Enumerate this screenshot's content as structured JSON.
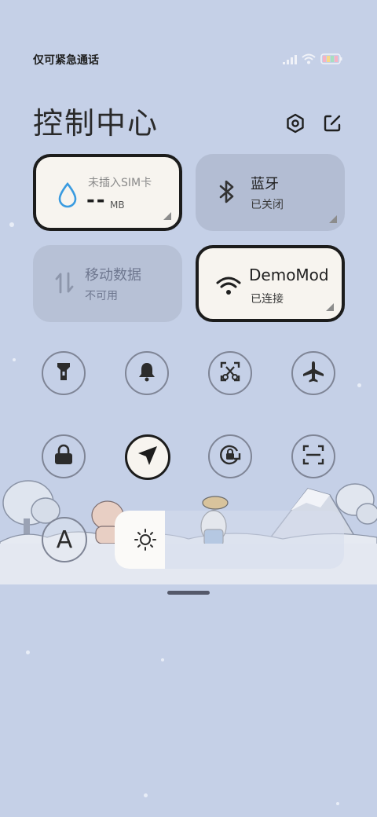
{
  "status": {
    "carrier_text": "仅可紧急通话",
    "icons": [
      "signal-icon",
      "wifi-icon",
      "battery-icon"
    ]
  },
  "header": {
    "title": "控制中心",
    "settings_icon": "gear-icon",
    "edit_icon": "edit-icon"
  },
  "tiles": {
    "data_usage": {
      "title": "未插入SIM卡",
      "value": "--",
      "unit": "MB"
    },
    "bluetooth": {
      "title": "蓝牙",
      "status": "已关闭"
    },
    "mobile_data": {
      "title": "移动数据",
      "status": "不可用"
    },
    "wifi": {
      "title": "DemoMod",
      "status": "已连接"
    }
  },
  "toggles_row1": [
    "flashlight-icon",
    "bell-icon",
    "screenshot-icon",
    "airplane-icon"
  ],
  "toggles_row2": [
    "lock-icon",
    "location-icon",
    "rotation-lock-icon",
    "scan-icon"
  ],
  "font_button": {
    "label": "A"
  },
  "brightness": {
    "level": 0.22
  },
  "colors": {
    "background": "#c5d0e7",
    "active_tile": "#f7f4ef",
    "inactive_tile": "#b3bdd3",
    "border_active": "#1c1c1c",
    "water_drop": "#3a9be0"
  }
}
